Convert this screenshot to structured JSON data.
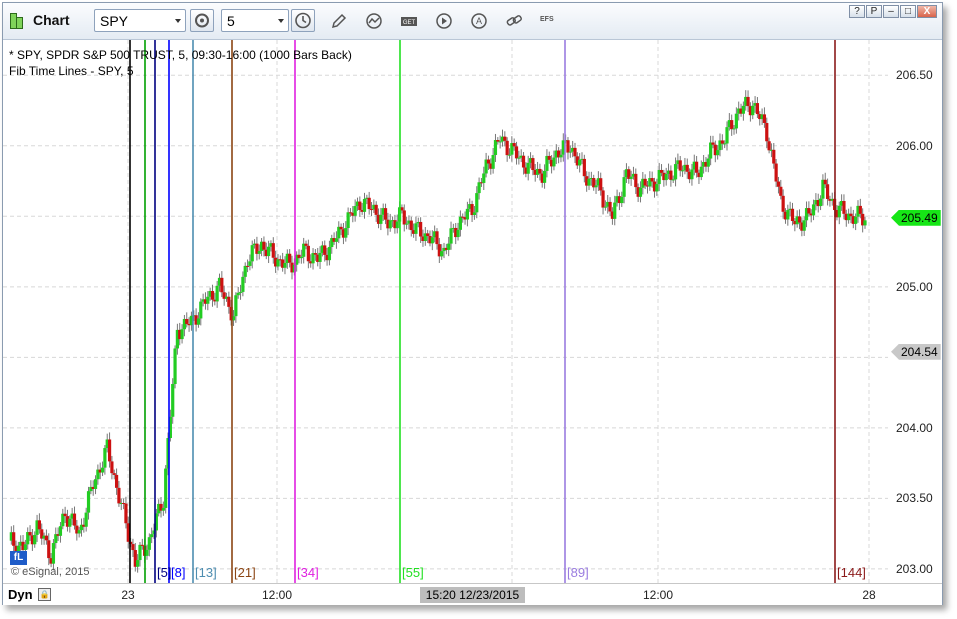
{
  "window": {
    "title": "Chart",
    "buttons": [
      "?",
      "P",
      "–",
      "□",
      "X"
    ]
  },
  "toolbar": {
    "symbol": "SPY",
    "interval": "5",
    "efs_label": "EFS",
    "tools": [
      "properties-icon",
      "clock-icon",
      "pencil-icon",
      "study-icon",
      "get-icon",
      "play-icon",
      "alert-icon",
      "link-icon"
    ]
  },
  "chart": {
    "info_line1": "* SPY, SPDR S&P 500 TRUST, 5, 09:30-16:00 (1000 Bars Back)",
    "info_line2": "Fib Time Lines - SPY, 5",
    "copyright": "© eSignal, 2015",
    "fl_badge": "fL",
    "dyn_label": "Dyn",
    "current_time": "15:20 12/23/2015",
    "x_ticks": [
      {
        "label": "23"
      },
      {
        "label": "12:00"
      },
      {
        "label": "12:00"
      },
      {
        "label": "28"
      }
    ],
    "y_ticks": [
      "206.50",
      "206.00",
      "205.00",
      "204.00",
      "203.50",
      "203.00"
    ],
    "last_price": {
      "value": "205.49",
      "color": "#16e616"
    },
    "ref_price": {
      "value": "204.54",
      "color": "#c8c8c8"
    },
    "fib_lines": [
      {
        "label": "",
        "color": "#000000"
      },
      {
        "label": "",
        "color": "#00a000"
      },
      {
        "label": "[5]",
        "color": "#000080"
      },
      {
        "label": "[8]",
        "color": "#0000ff"
      },
      {
        "label": "[13]",
        "color": "#4d8db0"
      },
      {
        "label": "[21]",
        "color": "#8b4513"
      },
      {
        "label": "[34]",
        "color": "#e020e0"
      },
      {
        "label": "[55]",
        "color": "#22e022"
      },
      {
        "label": "[89]",
        "color": "#9a7ce0"
      },
      {
        "label": "[144]",
        "color": "#8b1a1a"
      }
    ],
    "colors": {
      "up": "#22cc22",
      "down": "#cc1111",
      "grid": "#d8d8d8"
    }
  },
  "chart_data": {
    "type": "candlestick",
    "symbol": "SPY",
    "interval": "5",
    "y_range": [
      202.9,
      206.75
    ],
    "close_path": [
      [
        0,
        203.2
      ],
      [
        6,
        203.15
      ],
      [
        12,
        203.3
      ],
      [
        18,
        203.1
      ],
      [
        24,
        203.4
      ],
      [
        30,
        203.25
      ],
      [
        36,
        203.6
      ],
      [
        42,
        203.85
      ],
      [
        48,
        203.45
      ],
      [
        54,
        203.05
      ],
      [
        60,
        203.2
      ],
      [
        66,
        203.5
      ],
      [
        72,
        204.7
      ],
      [
        78,
        204.75
      ],
      [
        84,
        204.9
      ],
      [
        90,
        205.0
      ],
      [
        96,
        204.8
      ],
      [
        102,
        205.2
      ],
      [
        108,
        205.3
      ],
      [
        114,
        205.2
      ],
      [
        120,
        205.15
      ],
      [
        126,
        205.25
      ],
      [
        132,
        205.2
      ],
      [
        138,
        205.3
      ],
      [
        144,
        205.45
      ],
      [
        150,
        205.6
      ],
      [
        156,
        205.55
      ],
      [
        162,
        205.45
      ],
      [
        168,
        205.5
      ],
      [
        174,
        205.4
      ],
      [
        180,
        205.35
      ],
      [
        186,
        205.25
      ],
      [
        192,
        205.45
      ],
      [
        198,
        205.55
      ],
      [
        204,
        205.85
      ],
      [
        210,
        206.05
      ],
      [
        216,
        205.95
      ],
      [
        222,
        205.85
      ],
      [
        228,
        205.8
      ],
      [
        234,
        205.95
      ],
      [
        240,
        206.0
      ],
      [
        246,
        205.8
      ],
      [
        252,
        205.7
      ],
      [
        258,
        205.5
      ],
      [
        264,
        205.8
      ],
      [
        270,
        205.7
      ],
      [
        276,
        205.75
      ],
      [
        282,
        205.8
      ],
      [
        288,
        205.85
      ],
      [
        294,
        205.8
      ],
      [
        300,
        205.95
      ],
      [
        306,
        206.05
      ],
      [
        312,
        206.25
      ],
      [
        318,
        206.3
      ],
      [
        324,
        206.1
      ],
      [
        330,
        205.6
      ],
      [
        336,
        205.45
      ],
      [
        342,
        205.5
      ],
      [
        348,
        205.7
      ],
      [
        354,
        205.55
      ],
      [
        360,
        205.5
      ],
      [
        366,
        205.49
      ]
    ]
  }
}
